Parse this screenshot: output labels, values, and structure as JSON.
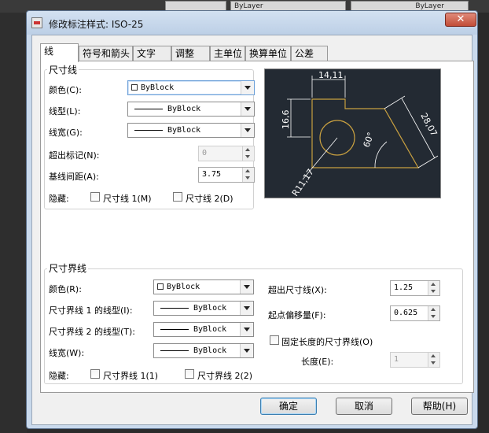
{
  "background_app": {
    "toolbar_layer_1": "ByLayer",
    "toolbar_layer_2": "ByLayer"
  },
  "dialog": {
    "title": "修改标注样式: ISO-25",
    "close_glyph": "✕"
  },
  "tabs": [
    {
      "label": "线",
      "active": true
    },
    {
      "label": "符号和箭头"
    },
    {
      "label": "文字"
    },
    {
      "label": "调整"
    },
    {
      "label": "主单位"
    },
    {
      "label": "换算单位"
    },
    {
      "label": "公差"
    }
  ],
  "dim_lines": {
    "group_label": "尺寸线",
    "color_label": "颜色(C):",
    "color_value": "ByBlock",
    "linetype_label": "线型(L):",
    "linetype_value": "ByBlock",
    "lineweight_label": "线宽(G):",
    "lineweight_value": "ByBlock",
    "extend_ticks_label": "超出标记(N):",
    "extend_ticks_value": "0",
    "baseline_spacing_label": "基线间距(A):",
    "baseline_spacing_value": "3.75",
    "suppress_label": "隐藏:",
    "suppress_1": "尺寸线 1(M)",
    "suppress_2": "尺寸线 2(D)"
  },
  "preview": {
    "dim_top": "14,11",
    "dim_left": "16,6",
    "dim_diag": "28,07",
    "angle": "60°",
    "radius": "R11,17"
  },
  "ext_lines": {
    "group_label": "尺寸界线",
    "color_label": "颜色(R):",
    "color_value": "ByBlock",
    "linetype1_label": "尺寸界线 1 的线型(I):",
    "linetype1_value": "ByBlock",
    "linetype2_label": "尺寸界线 2 的线型(T):",
    "linetype2_value": "ByBlock",
    "lineweight_label": "线宽(W):",
    "lineweight_value": "ByBlock",
    "suppress_label": "隐藏:",
    "suppress_1": "尺寸界线 1(1)",
    "suppress_2": "尺寸界线 2(2)",
    "extend_beyond_label": "超出尺寸线(X):",
    "extend_beyond_value": "1.25",
    "offset_label": "起点偏移量(F):",
    "offset_value": "0.625",
    "fixed_length_label": "固定长度的尺寸界线(O)",
    "length_label": "长度(E):",
    "length_value": "1"
  },
  "buttons": {
    "ok": "确定",
    "cancel": "取消",
    "help": "帮助(H)"
  },
  "colors": {
    "preview_bg": "#232a33",
    "preview_geometry": "#c8a040",
    "preview_dims": "#ffffff"
  }
}
